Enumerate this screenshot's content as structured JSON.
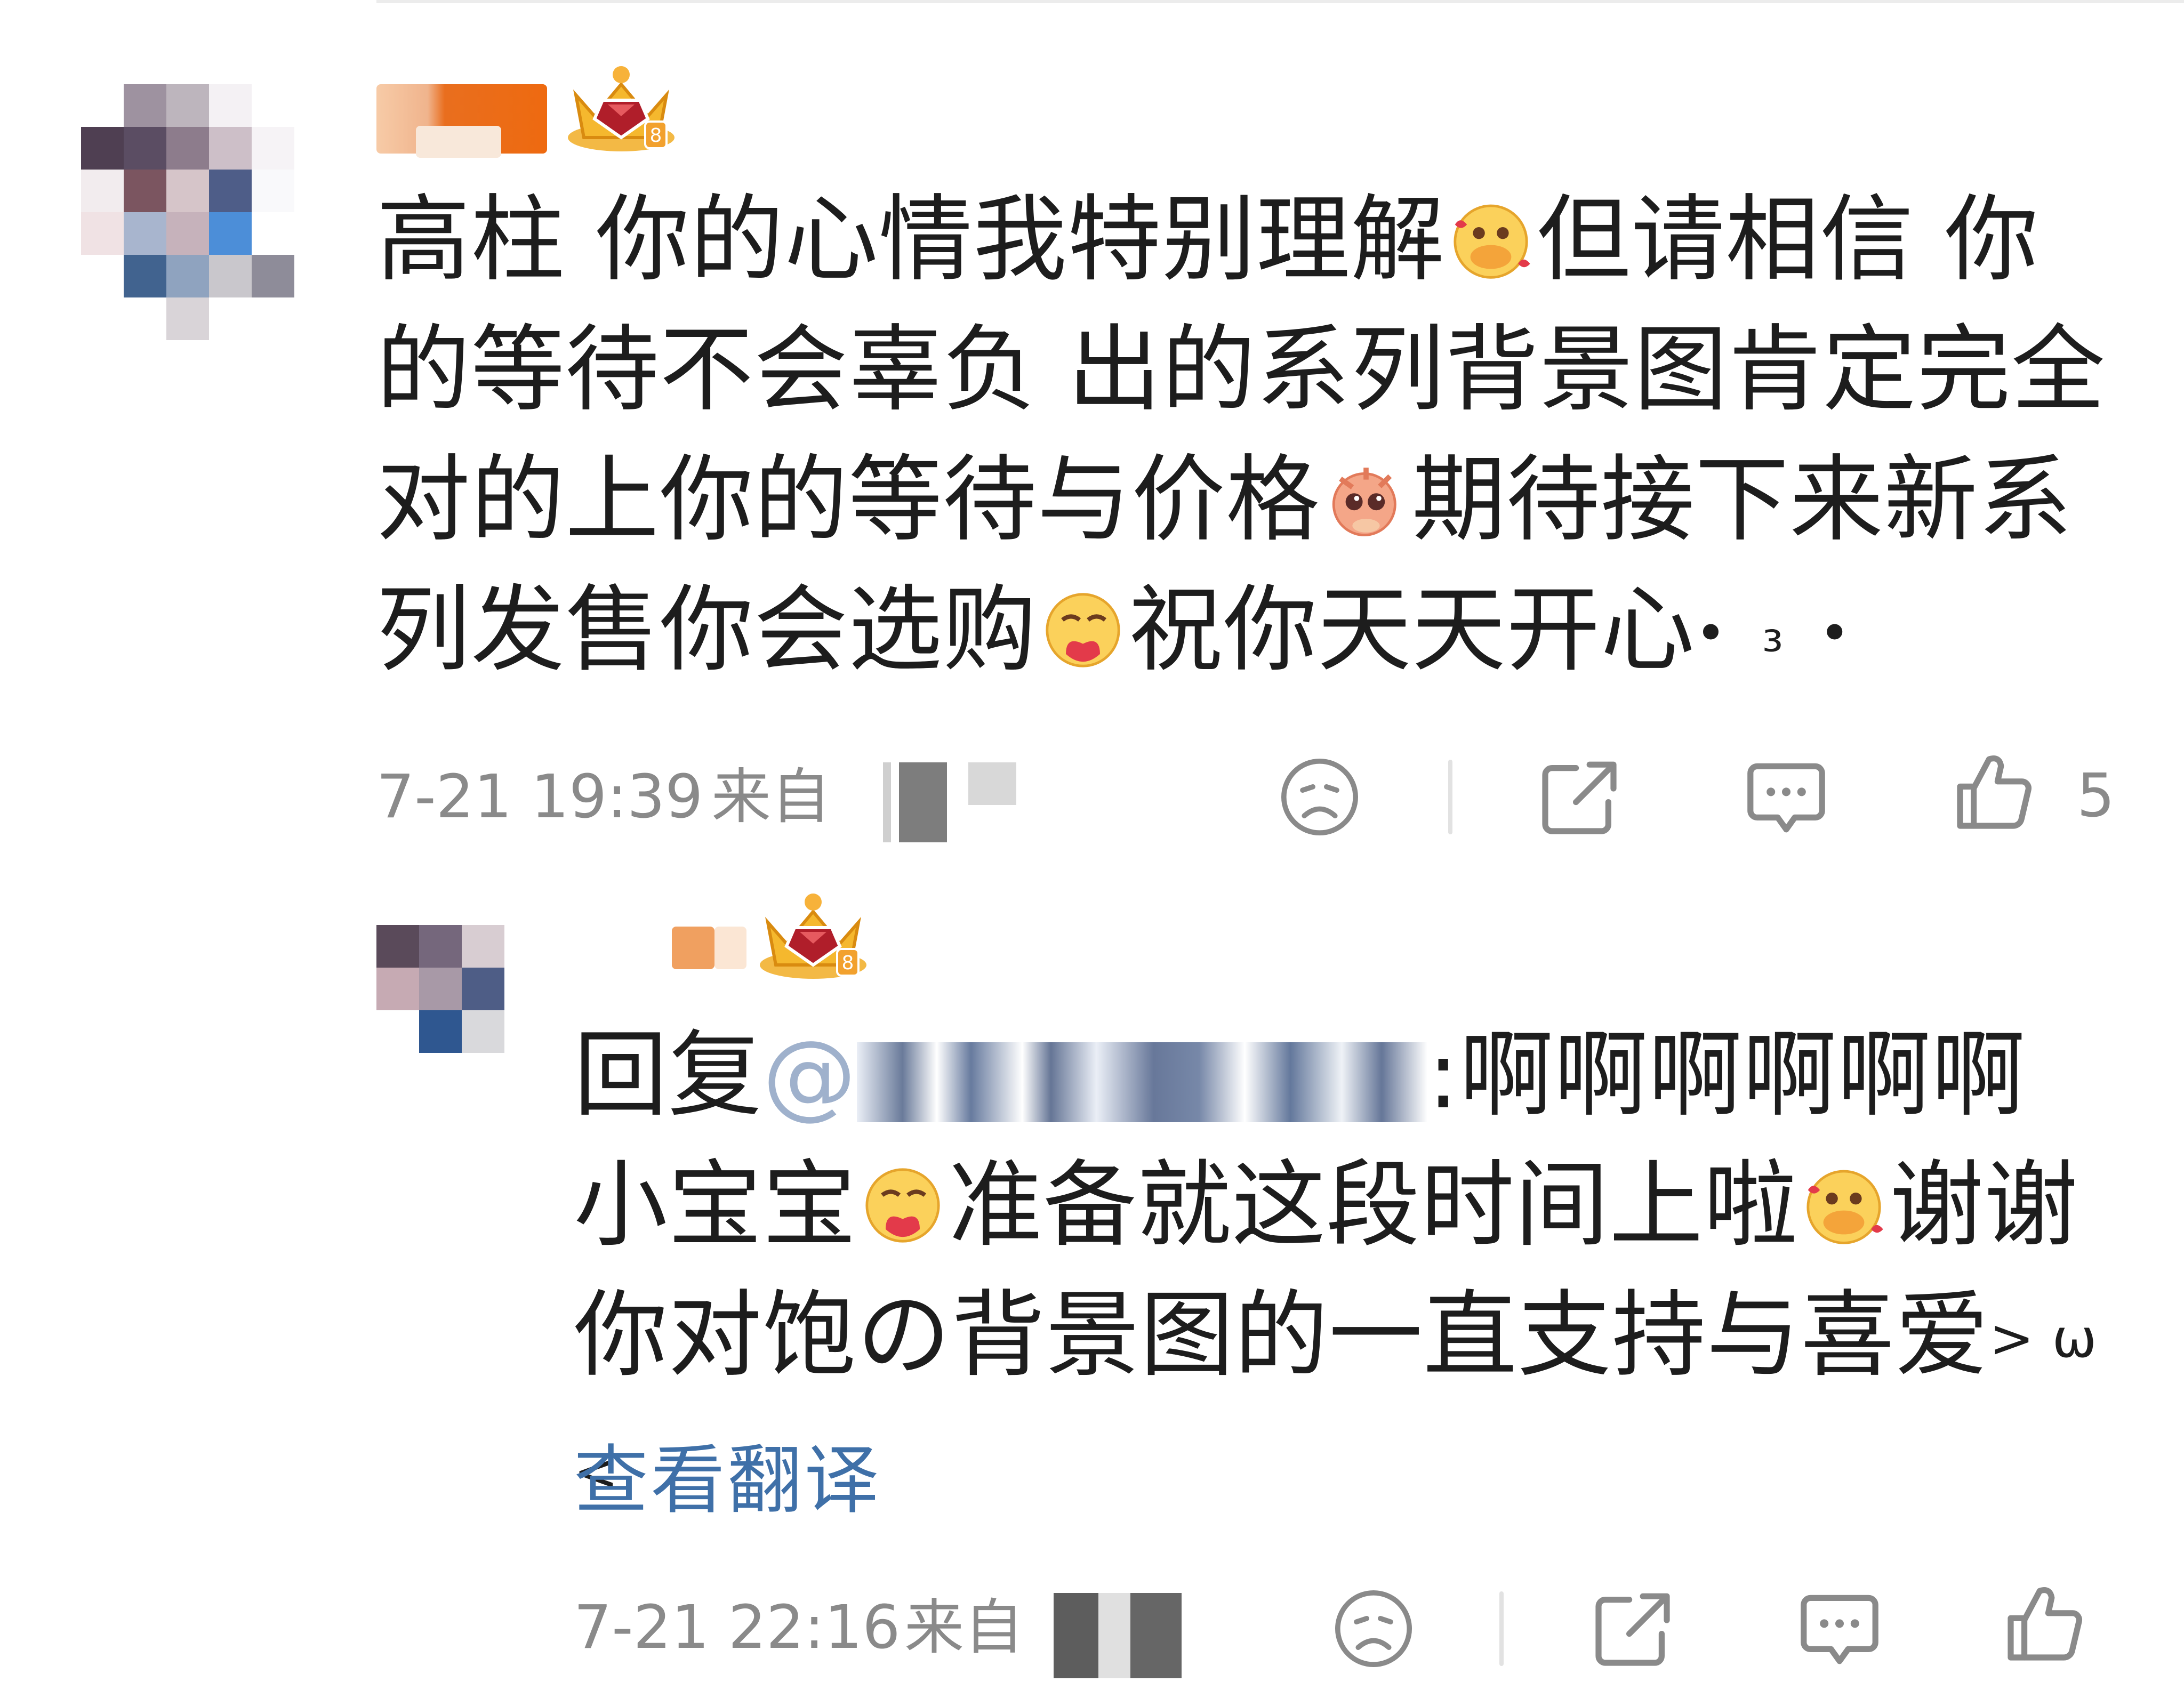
{
  "main_comment": {
    "text_part1": "高柱 你的心情我特别理解",
    "text_part2": "但请相信 你的等待不会辜负 出的系列背景图肯定完全对的上你的等待与价格",
    "text_part3": "期待接下来新系列发售你会选购",
    "text_part4": "祝你天天开心",
    "kaomoji": "•  ₃  •",
    "timestamp": "7-21 19:39",
    "source_label": "来自",
    "like_count": "5",
    "badge_icon": "crown-badge-icon"
  },
  "reply_comment": {
    "reply_prefix": "回复",
    "mention_prefix": "@",
    "text_part1": ":啊啊啊啊啊啊小宝宝",
    "text_part2": "准备就这段时间上啦",
    "text_part3": "谢谢你对饱の背景图的一直支持与喜爱",
    "kaomoji": "> ω <",
    "translate_link": "查看翻译",
    "timestamp": "7-21 22:16",
    "source_label": "来自",
    "badge_icon": "crown-badge-icon"
  },
  "icons": {
    "dislike": "sad-face-icon",
    "share": "share-icon",
    "comment": "comment-bubble-icon",
    "like": "thumbs-up-icon"
  },
  "colors": {
    "link": "#3f70a8",
    "meta_gray": "#8a8a8a",
    "text": "#1d1d1d",
    "badge_gold": "#f5b82e"
  }
}
